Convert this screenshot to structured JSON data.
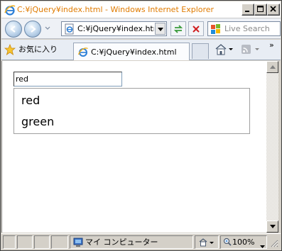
{
  "window": {
    "title": "C:¥jQuery¥index.html - Windows Internet Explorer"
  },
  "toolbar": {
    "address": "C:¥jQuery¥index.html",
    "search_placeholder": "Live Search"
  },
  "favorites_bar": {
    "favorites_label": "お気に入り",
    "tab_title": "C:¥jQuery¥index.html"
  },
  "page": {
    "autocomplete_input_value": "red",
    "suggestions": [
      "red",
      "green"
    ]
  },
  "statusbar": {
    "zone": "マイ コンピューター",
    "zoom": "100%"
  },
  "colors": {
    "title_text": "#e07b00",
    "window_chrome": "#d4d0c8"
  }
}
